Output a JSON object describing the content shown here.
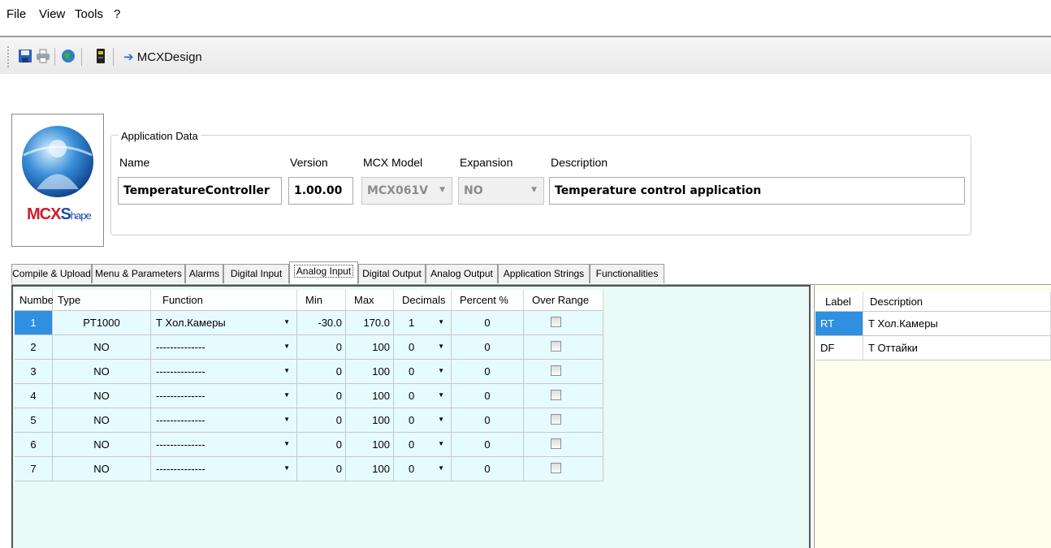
{
  "menu": {
    "items": [
      "File",
      "View",
      "Tools",
      "?"
    ]
  },
  "toolbar": {
    "icons": [
      "save-icon",
      "print-icon",
      "globe-icon",
      "device-icon"
    ],
    "link_label": "MCXDesign"
  },
  "logo": {
    "brand_mcx": "MCX",
    "brand_s": "S",
    "brand_hape": "hape"
  },
  "app_data": {
    "legend": "Application Data",
    "name_label": "Name",
    "name_value": "TemperatureController",
    "version_label": "Version",
    "version_value": "1.00.00",
    "model_label": "MCX Model",
    "model_value": "MCX061V",
    "expansion_label": "Expansion",
    "expansion_value": "NO",
    "description_label": "Description",
    "description_value": "Temperature control application"
  },
  "tabs": [
    "Compile & Upload",
    "Menu & Parameters",
    "Alarms",
    "Digital Input",
    "Analog Input",
    "Digital Output",
    "Analog Output",
    "Application Strings",
    "Functionalities"
  ],
  "active_tab": "Analog Input",
  "grid": {
    "headers": [
      "Number",
      "Type",
      "Function",
      "Min",
      "Max",
      "Decimals",
      "Percent %",
      "Over Range"
    ],
    "rows": [
      {
        "number": "1",
        "type": "PT1000",
        "function": "Т Хол.Камеры",
        "min": "-30.0",
        "max": "170.0",
        "decimals": "1",
        "percent": "0",
        "over_range": false,
        "selected": true
      },
      {
        "number": "2",
        "type": "NO",
        "function": "--------------",
        "min": "0",
        "max": "100",
        "decimals": "0",
        "percent": "0",
        "over_range": false,
        "selected": false
      },
      {
        "number": "3",
        "type": "NO",
        "function": "--------------",
        "min": "0",
        "max": "100",
        "decimals": "0",
        "percent": "0",
        "over_range": false,
        "selected": false
      },
      {
        "number": "4",
        "type": "NO",
        "function": "--------------",
        "min": "0",
        "max": "100",
        "decimals": "0",
        "percent": "0",
        "over_range": false,
        "selected": false
      },
      {
        "number": "5",
        "type": "NO",
        "function": "--------------",
        "min": "0",
        "max": "100",
        "decimals": "0",
        "percent": "0",
        "over_range": false,
        "selected": false
      },
      {
        "number": "6",
        "type": "NO",
        "function": "--------------",
        "min": "0",
        "max": "100",
        "decimals": "0",
        "percent": "0",
        "over_range": false,
        "selected": false
      },
      {
        "number": "7",
        "type": "NO",
        "function": "--------------",
        "min": "0",
        "max": "100",
        "decimals": "0",
        "percent": "0",
        "over_range": false,
        "selected": false
      }
    ]
  },
  "labels_table": {
    "headers": [
      "Label",
      "Description"
    ],
    "rows": [
      {
        "label": "RT",
        "description": "Т Хол.Камеры",
        "selected": true
      },
      {
        "label": "DF",
        "description": "Т Оттайки",
        "selected": false
      }
    ]
  },
  "colors": {
    "selection": "#2f8fe0",
    "grid_row": "#e6fbff",
    "grid_panel": "#eafaf6",
    "labels_panel": "#fdfeec"
  }
}
